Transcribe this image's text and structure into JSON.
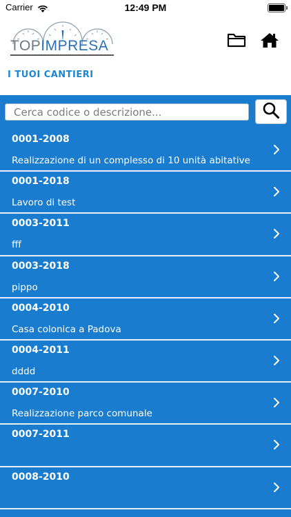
{
  "status_bar": {
    "carrier": "Carrier",
    "time": "12:49 PM"
  },
  "header": {
    "logo_top": "TOP",
    "logo_bottom": "IMPRESA",
    "section_title": "I TUOI CANTIERI"
  },
  "search": {
    "placeholder": "Cerca codice o descrizione..."
  },
  "colors": {
    "accent": "#1a7ccf",
    "title": "#1a86d6"
  },
  "items": [
    {
      "code": "0001-2008",
      "desc": "Realizzazione di un complesso di 10 unità abitative"
    },
    {
      "code": "0001-2018",
      "desc": "Lavoro di test"
    },
    {
      "code": "0003-2011",
      "desc": "fff"
    },
    {
      "code": "0003-2018",
      "desc": "pippo"
    },
    {
      "code": "0004-2010",
      "desc": "Casa colonica a Padova"
    },
    {
      "code": "0004-2011",
      "desc": "dddd"
    },
    {
      "code": "0007-2010",
      "desc": "Realizzazione parco comunale"
    },
    {
      "code": "0007-2011",
      "desc": ""
    },
    {
      "code": "0008-2010",
      "desc": ""
    }
  ]
}
